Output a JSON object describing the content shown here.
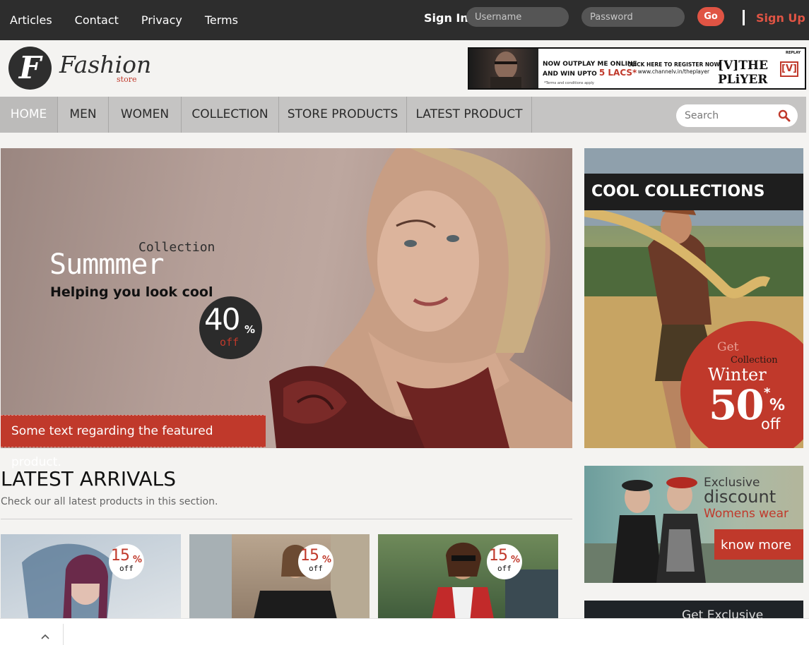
{
  "topbar": {
    "links": [
      "Articles",
      "Contact",
      "Privacy",
      "Terms"
    ],
    "sign_in_label": "Sign In",
    "username_placeholder": "Username",
    "password_placeholder": "Password",
    "go_label": "Go",
    "sign_up_label": "Sign Up"
  },
  "logo": {
    "letter": "F",
    "word": "Fashion",
    "sub": "store"
  },
  "ad": {
    "line1": "NOW OUTPLAY ME ONLINE",
    "line2a": "AND WIN UPTO ",
    "line2b": "5 LACS*",
    "line3": "CLICK HERE TO REGISTER NOW",
    "line4": "www.channelv.in/theplayer",
    "terms": "*Terms and conditions apply",
    "brand": "[V]THE PLiYER",
    "channel": "[V]",
    "replay": "REPLAY"
  },
  "nav": {
    "items": [
      "HOME",
      "MEN",
      "WOMEN",
      "COLLECTION",
      "STORE PRODUCTS",
      "LATEST PRODUCT"
    ],
    "active": "HOME",
    "search_placeholder": "Search"
  },
  "hero": {
    "collection": "Collection",
    "title": "Summmer",
    "tagline": "Helping you look cool",
    "discount_number": "40",
    "discount_percent": "%",
    "discount_off": "off",
    "caption": "Some text regarding the featured product."
  },
  "cool": {
    "heading": "COOL COLLECTIONS",
    "get": "Get",
    "collection": "Collection",
    "season": "Winter",
    "number": "50",
    "star": "*",
    "percent": "%",
    "off": "off"
  },
  "exclusive": {
    "line1": "Exclusive",
    "line2": "discount",
    "line3": "Womens wear",
    "button": "know more"
  },
  "get_exclusive": {
    "text": "Get Exclusive"
  },
  "latest": {
    "title": "LATEST ARRIVALS",
    "subtitle": "Check our all latest products in this section.",
    "products": [
      {
        "discount": "15",
        "percent": "%",
        "off": "off"
      },
      {
        "discount": "15",
        "percent": "%",
        "off": "off"
      },
      {
        "discount": "15",
        "percent": "%",
        "off": "off"
      }
    ]
  },
  "colors": {
    "accent": "#c0392b",
    "topbar": "#2d2d2d",
    "nav": "#c5c4c3",
    "go_button": "#e05444"
  }
}
